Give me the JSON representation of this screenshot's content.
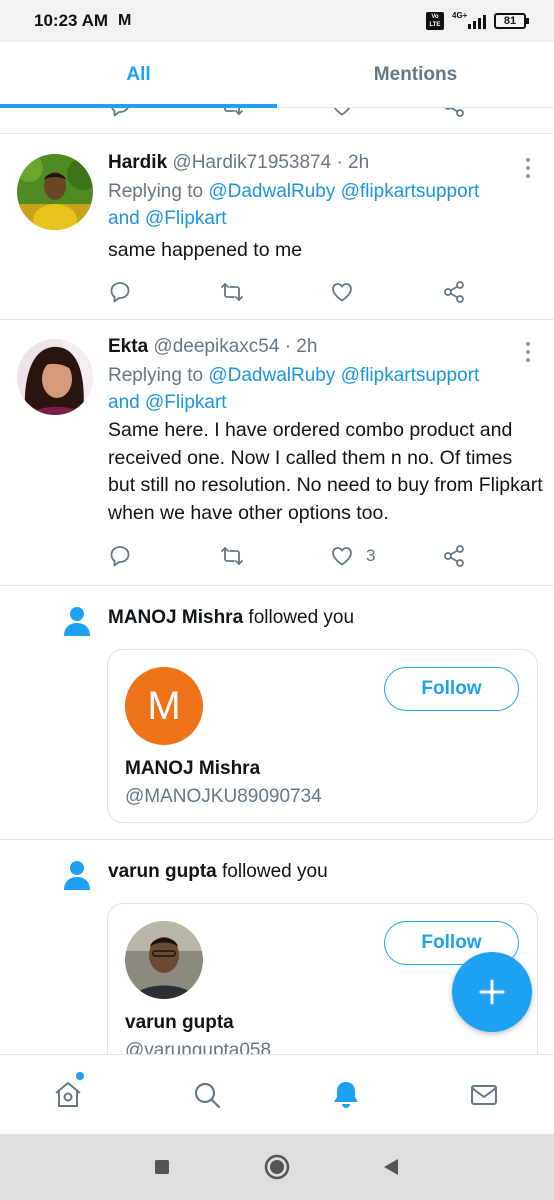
{
  "status_bar": {
    "time": "10:23 AM",
    "carrier_icon": "M",
    "volte": "Vo LTE",
    "network": "4G+",
    "battery": "81"
  },
  "tabs": [
    {
      "label": "All",
      "active": true
    },
    {
      "label": "Mentions",
      "active": false
    }
  ],
  "tweets": [
    {
      "name": "Hardik",
      "handle": "@Hardik71953874",
      "time": "· 2h",
      "replying_prefix": "Replying to ",
      "replying_1": "@DadwalRuby",
      "replying_2": "@flipkartsupport",
      "replying_and": "and ",
      "replying_3": "@Flipkart",
      "text": "same happened to me",
      "like_count": ""
    },
    {
      "name": "Ekta",
      "handle": "@deepikaxc54",
      "time": "· 2h",
      "replying_prefix": "Replying to ",
      "replying_1": "@DadwalRuby",
      "replying_2": "@flipkartsupport",
      "replying_and": "and ",
      "replying_3": "@Flipkart",
      "text": "Same here. I have ordered combo product and received one. Now I called them n no. Of times but still no resolution. No need to buy from Flipkart when we have other options too.",
      "like_count": "3"
    }
  ],
  "follows": [
    {
      "name": "MANOJ Mishra",
      "suffix": " followed you",
      "card_name": "MANOJ Mishra",
      "handle": "@MANOJKU89090734",
      "initial": "M",
      "avatar_color": "#EE7217",
      "button": "Follow"
    },
    {
      "name": "varun gupta",
      "suffix": " followed you",
      "card_name": "varun gupta",
      "handle": "@varungupta058",
      "button": "Follow"
    }
  ],
  "icons": {
    "actions": [
      "reply-icon",
      "retweet-icon",
      "like-icon",
      "share-icon"
    ],
    "nav": [
      "home-icon",
      "search-icon",
      "notifications-icon",
      "messages-icon"
    ],
    "fab": "compose-plus-icon",
    "system": [
      "recents-square-icon",
      "home-circle-icon",
      "back-triangle-icon"
    ]
  },
  "colors": {
    "accent": "#1DA1F2",
    "link": "#1B95E0",
    "secondary_text": "#657786",
    "divider": "#E1E8ED"
  }
}
